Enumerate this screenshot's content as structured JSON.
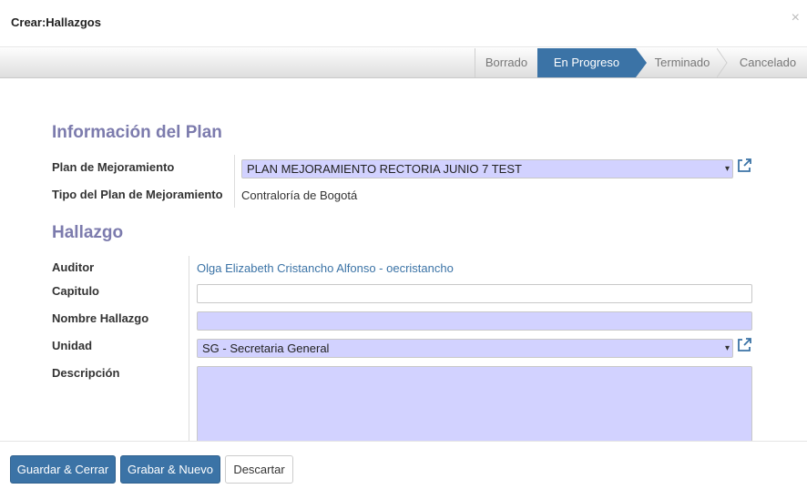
{
  "dialog": {
    "title": "Crear:Hallazgos",
    "close_glyph": "×"
  },
  "statusbar": {
    "stages": [
      {
        "label": "Borrado",
        "active": false
      },
      {
        "label": "En Progreso",
        "active": true
      },
      {
        "label": "Terminado",
        "active": false
      },
      {
        "label": "Cancelado",
        "active": false
      }
    ]
  },
  "plan_section": {
    "heading": "Información del Plan",
    "plan_label": "Plan de Mejoramiento",
    "plan_value": "PLAN MEJORAMIENTO RECTORIA JUNIO 7 TEST",
    "tipo_label": "Tipo del Plan de Mejoramiento",
    "tipo_value": "Contraloría de Bogotá"
  },
  "hallazgo_section": {
    "heading": "Hallazgo",
    "auditor_label": "Auditor",
    "auditor_value": "Olga Elizabeth Cristancho Alfonso - oecristancho",
    "capitulo_label": "Capitulo",
    "capitulo_value": "",
    "nombre_label": "Nombre Hallazgo",
    "nombre_value": "",
    "unidad_label": "Unidad",
    "unidad_value": "SG - Secretaria General",
    "descripcion_label": "Descripción",
    "descripcion_value": ""
  },
  "footer": {
    "save_close": "Guardar & Cerrar",
    "save_new": "Grabar & Nuevo",
    "discard": "Descartar"
  },
  "icons": {
    "dropdown": "▾",
    "external_link": "external-link-icon"
  },
  "colors": {
    "primary": "#3b73a6",
    "required_field": "#d2d2ff",
    "heading": "#7c7bad",
    "link": "#3b73a6"
  }
}
